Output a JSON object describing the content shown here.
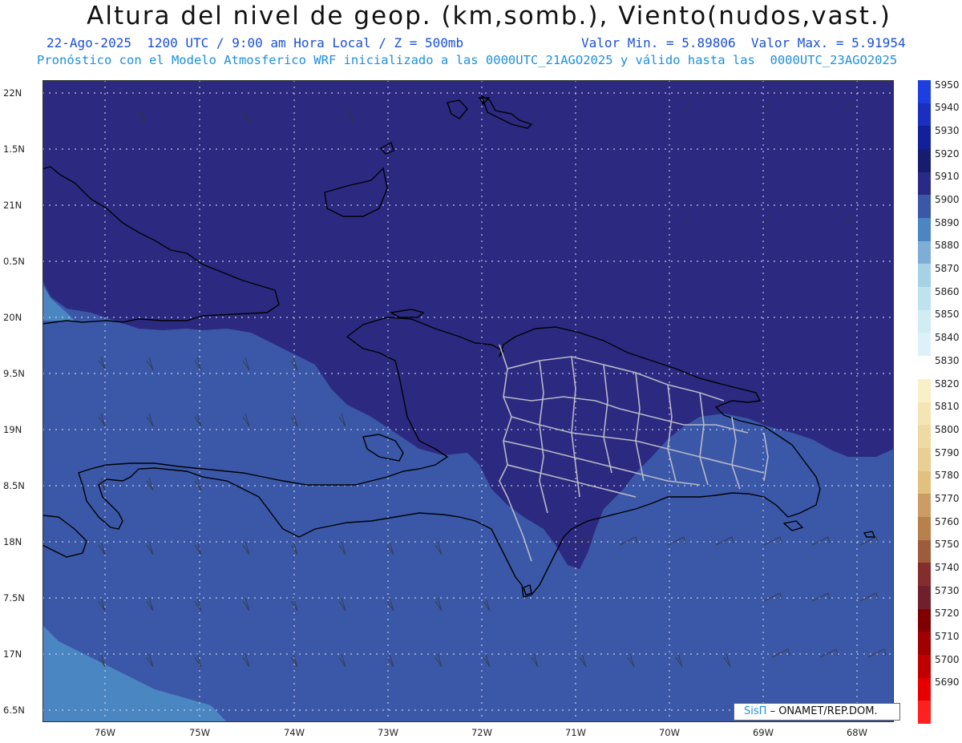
{
  "title": "Altura del nivel de geop. (km,somb.), Viento(nudos,vast.)",
  "subtitle_left": "22-Ago-2025  1200 UTC / 9:00 am Hora Local / Z = 500mb",
  "subtitle_right": "Valor Min. = 5.89806  Valor Max. = 5.91954",
  "subtitle2": "Pronóstico con el Modelo Atmosferico WRF inicializado a las 0000UTC_21AGO2025 y válido hasta las  0000UTC_23AGO2025",
  "lat_labels": [
    "22N",
    "1.5N",
    "21N",
    "0.5N",
    "20N",
    "9.5N",
    "19N",
    "8.5N",
    "18N",
    "7.5N",
    "17N",
    "6.5N"
  ],
  "lon_labels": [
    "76W",
    "75W",
    "74W",
    "73W",
    "72W",
    "71W",
    "70W",
    "69W",
    "68W"
  ],
  "colorbar": {
    "levels": [
      "5950",
      "5940",
      "5930",
      "5920",
      "5910",
      "5900",
      "5890",
      "5880",
      "5870",
      "5860",
      "5850",
      "5840",
      "5830",
      "5820",
      "5810",
      "5800",
      "5790",
      "5780",
      "5770",
      "5760",
      "5750",
      "5740",
      "5730",
      "5720",
      "5710",
      "5700",
      "5690"
    ],
    "colors": [
      "#1e3fe0",
      "#1a2fc0",
      "#12209a",
      "#161d6e",
      "#2a2a86",
      "#3b58a8",
      "#4a86c2",
      "#7eaed6",
      "#a6d2e6",
      "#bfe3ee",
      "#d2ecf4",
      "#dcf2f8",
      "#ffffff",
      "#faf0c8",
      "#f5e5b4",
      "#efdaa4",
      "#eacf94",
      "#e1c080",
      "#cc9c64",
      "#b8804a",
      "#9e5c3c",
      "#852c2c",
      "#70202c",
      "#800000",
      "#a00000",
      "#c00000",
      "#e80000",
      "#ff2020"
    ]
  },
  "credit": {
    "logo": "SisΠ",
    "text": "– ONAMET/REP.DOM."
  },
  "colors": {
    "high": "#2c2a80",
    "mid": "#3b58a8",
    "low": "#4a86c2"
  }
}
